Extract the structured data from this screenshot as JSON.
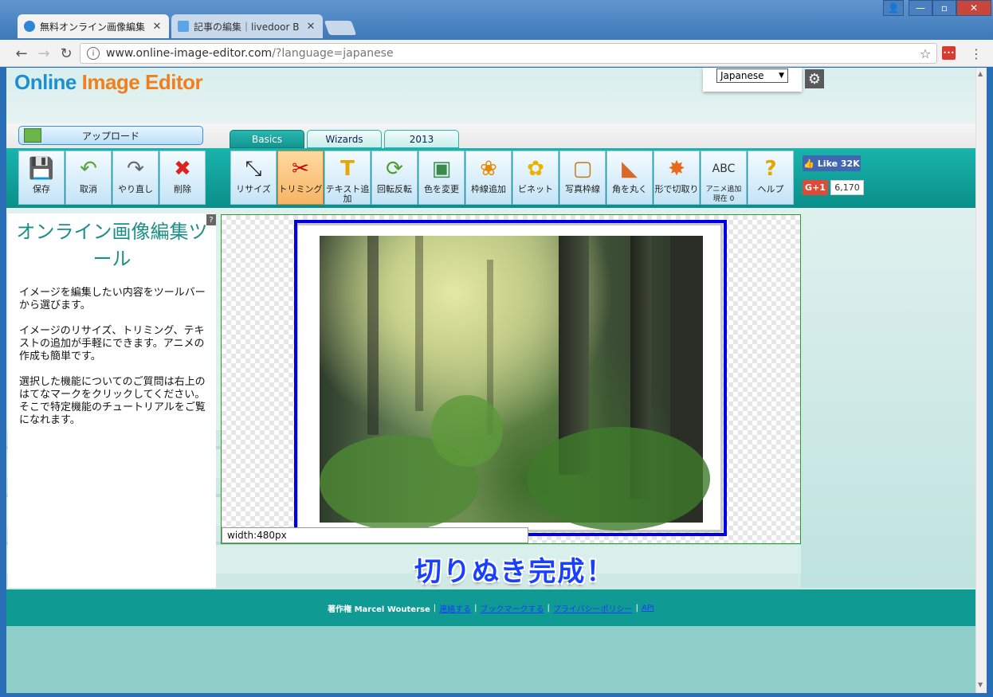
{
  "browser": {
    "tabs": [
      {
        "title": "無料オンライン画像編集",
        "active": true
      },
      {
        "title": "記事の編集｜livedoor B",
        "active": false
      }
    ],
    "url_host": "www.online-image-editor.com",
    "url_path": "/?language=japanese"
  },
  "site": {
    "logo_part1": "Online ",
    "logo_part2": "Image Editor",
    "language": "Japanese",
    "upload_label": "アップロード",
    "tabs": [
      "Basics",
      "Wizards",
      "2013"
    ],
    "tools_left": [
      {
        "label": "保存",
        "icon": "floppy-icon"
      },
      {
        "label": "取消",
        "icon": "undo-icon"
      },
      {
        "label": "やり直し",
        "icon": "redo-icon"
      },
      {
        "label": "削除",
        "icon": "delete-icon"
      }
    ],
    "tools_right": [
      {
        "label": "リサイズ",
        "icon": "resize-icon"
      },
      {
        "label": "トリミング",
        "icon": "scissors-icon"
      },
      {
        "label": "テキスト追加",
        "icon": "text-icon"
      },
      {
        "label": "回転反転",
        "icon": "rotate-icon"
      },
      {
        "label": "色を変更",
        "icon": "color-icon"
      },
      {
        "label": "枠線追加",
        "icon": "border-icon"
      },
      {
        "label": "ビネット",
        "icon": "vignette-icon"
      },
      {
        "label": "写真枠線",
        "icon": "frame-icon"
      },
      {
        "label": "角を丸く",
        "icon": "round-corner-icon"
      },
      {
        "label": "形で切取り",
        "icon": "shape-cut-icon"
      },
      {
        "label": "アニメ追加 現在 0",
        "icon": "animation-icon"
      },
      {
        "label": "ヘルプ",
        "icon": "help-icon"
      }
    ],
    "fb_like": "Like 32K",
    "gplus_label": "G+1",
    "gplus_count": "6,170"
  },
  "sidebar": {
    "title": "オンライン画像編集ツール",
    "paragraphs": [
      "イメージを編集したい内容をツールバーから選びます。",
      "イメージのリサイズ、トリミング、テキストの追加が手軽にできます。アニメの作成も簡単です。",
      "選択した機能についてのご質問は右上のはてなマークをクリックしてください。 そこで特定機能のチュートリアルをご覧になれます。"
    ]
  },
  "canvas": {
    "info": "width:480px"
  },
  "caption": "切りぬき完成！",
  "footer": {
    "copyright": "著作権 Marcel Wouterse",
    "links": [
      "連絡する",
      "ブックマークする",
      "プライバシーポリシー",
      "API"
    ]
  }
}
